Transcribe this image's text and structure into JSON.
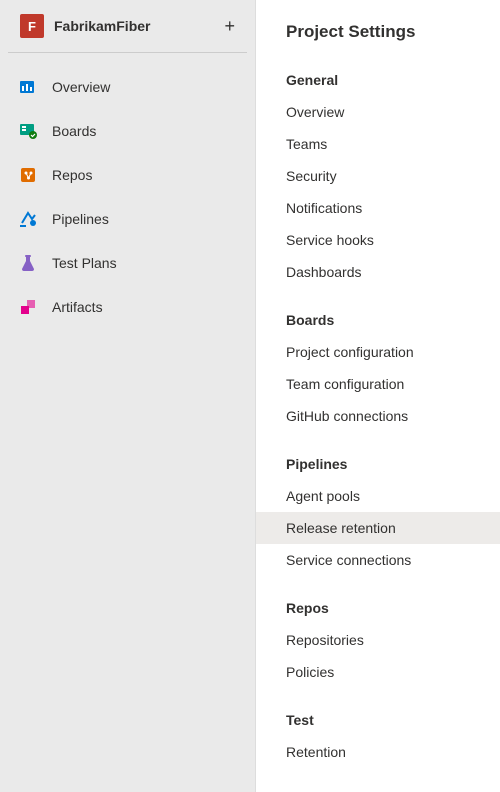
{
  "project": {
    "badge": "F",
    "name": "FabrikamFiber"
  },
  "nav": {
    "items": [
      {
        "label": "Overview"
      },
      {
        "label": "Boards"
      },
      {
        "label": "Repos"
      },
      {
        "label": "Pipelines"
      },
      {
        "label": "Test Plans"
      },
      {
        "label": "Artifacts"
      }
    ]
  },
  "settings": {
    "title": "Project Settings",
    "sections": {
      "general": {
        "header": "General",
        "items": [
          "Overview",
          "Teams",
          "Security",
          "Notifications",
          "Service hooks",
          "Dashboards"
        ]
      },
      "boards": {
        "header": "Boards",
        "items": [
          "Project configuration",
          "Team configuration",
          "GitHub connections"
        ]
      },
      "pipelines": {
        "header": "Pipelines",
        "items": [
          "Agent pools",
          "Release retention",
          "Service connections"
        ]
      },
      "repos": {
        "header": "Repos",
        "items": [
          "Repositories",
          "Policies"
        ]
      },
      "test": {
        "header": "Test",
        "items": [
          "Retention"
        ]
      }
    },
    "selected": "Release retention"
  }
}
